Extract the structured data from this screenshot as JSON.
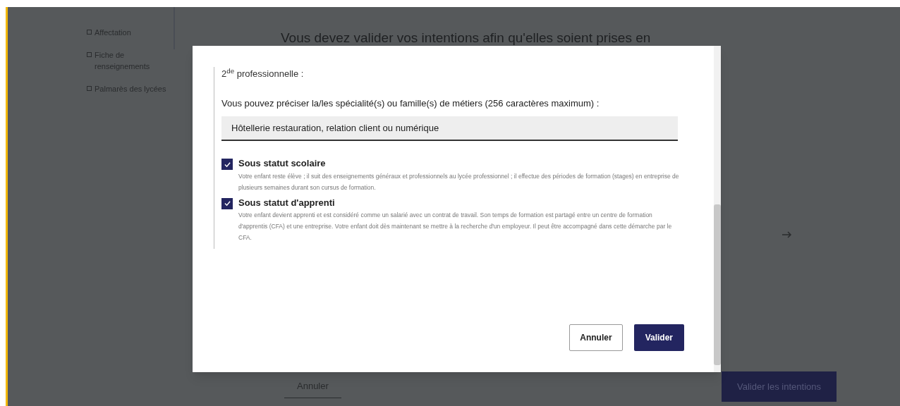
{
  "sidebar": {
    "items": [
      {
        "label": "Affectation"
      },
      {
        "label": "Fiche de renseignements"
      },
      {
        "label": "Palmarès des lycées"
      }
    ]
  },
  "page": {
    "heading": "Vous devez valider vos intentions afin qu'elles soient prises en",
    "cancel": "Annuler",
    "submit": "Valider les intentions"
  },
  "dialog": {
    "title": "2$^{de}$ professionnelle :",
    "field_label": "Vous pouvez préciser la/les spécialité(s) ou famille(s) de métiers (256 caractères maximum) :",
    "field_value": "Hôtellerie restauration, relation client ou numérique",
    "options": [
      {
        "label": "Sous statut scolaire",
        "checked": true,
        "description": "Votre enfant reste élève ; il suit des enseignements généraux et professionnels au lycée professionnel ; il effectue des périodes de formation (stages) en entreprise de plusieurs semaines durant son cursus de formation."
      },
      {
        "label": "Sous statut d'apprenti",
        "checked": true,
        "description": "Votre enfant devient apprenti et est considéré comme un salarié avec un contrat de travail. Son temps de formation est partagé entre un centre de formation d'apprentis (CFA) et une entreprise. Votre enfant doit dès maintenant se mettre à la recherche d'un employeur. Il peut être accompagné dans cette démarche par le CFA."
      }
    ],
    "cancel": "Annuler",
    "submit": "Valider"
  }
}
